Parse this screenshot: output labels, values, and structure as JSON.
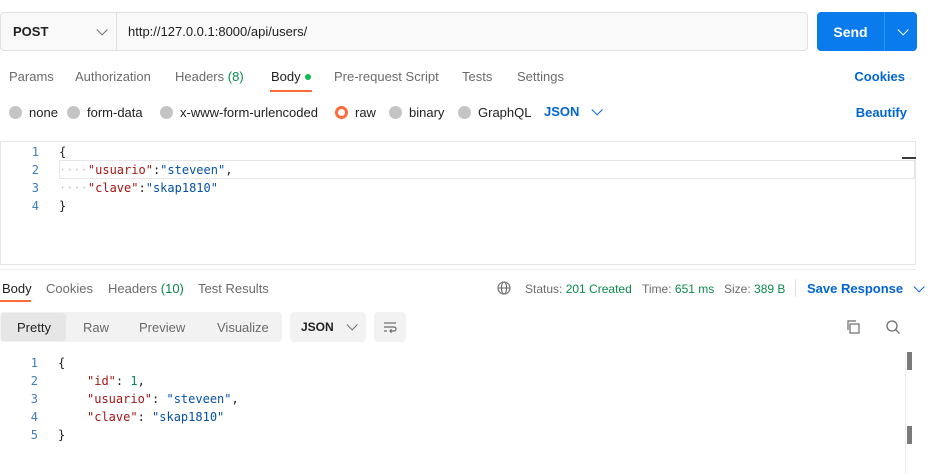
{
  "request": {
    "method": "POST",
    "url": "http://127.0.0.1:8000/api/users/",
    "send_label": "Send"
  },
  "request_tabs": [
    {
      "label": "Params",
      "count": ""
    },
    {
      "label": "Authorization",
      "count": ""
    },
    {
      "label": "Headers",
      "count": "(8)"
    },
    {
      "label": "Body",
      "count": ""
    },
    {
      "label": "Pre-request Script",
      "count": ""
    },
    {
      "label": "Tests",
      "count": ""
    },
    {
      "label": "Settings",
      "count": ""
    }
  ],
  "cookies_label": "Cookies",
  "body_types": [
    "none",
    "form-data",
    "x-www-form-urlencoded",
    "raw",
    "binary",
    "GraphQL"
  ],
  "body_format": "JSON",
  "beautify_label": "Beautify",
  "request_body": {
    "line_numbers": [
      "1",
      "2",
      "3",
      "4"
    ],
    "open_brace": "{",
    "close_brace": "}",
    "fields": [
      {
        "indent": "····",
        "key": "\"usuario\"",
        "sep": ":",
        "value": "\"steveen\"",
        "trail": ","
      },
      {
        "indent": "····",
        "key": "\"clave\"",
        "sep": ":",
        "value": "\"skap1810\"",
        "trail": ""
      }
    ]
  },
  "response_tabs": [
    {
      "label": "Body",
      "count": ""
    },
    {
      "label": "Cookies",
      "count": ""
    },
    {
      "label": "Headers",
      "count": "(10)"
    },
    {
      "label": "Test Results",
      "count": ""
    }
  ],
  "response_status": {
    "status_label": "Status:",
    "status_value": "201 Created",
    "time_label": "Time:",
    "time_value": "651 ms",
    "size_label": "Size:",
    "size_value": "389 B"
  },
  "save_response_label": "Save Response",
  "view_modes": [
    "Pretty",
    "Raw",
    "Preview",
    "Visualize"
  ],
  "response_format": "JSON",
  "response_body": {
    "line_numbers": [
      "1",
      "2",
      "3",
      "4",
      "5"
    ],
    "open_brace": "{",
    "close_brace": "}",
    "fields": [
      {
        "key": "\"id\"",
        "sep": ": ",
        "value": "1",
        "trail": ","
      },
      {
        "key": "\"usuario\"",
        "sep": ": ",
        "value": "\"steveen\"",
        "trail": ","
      },
      {
        "key": "\"clave\"",
        "sep": ": ",
        "value": "\"skap1810\"",
        "trail": ""
      }
    ]
  },
  "colors": {
    "accent_orange": "#ff6c37",
    "send_blue": "#097bed",
    "link_blue": "#0265d2",
    "status_green": "#0a8a4a"
  }
}
